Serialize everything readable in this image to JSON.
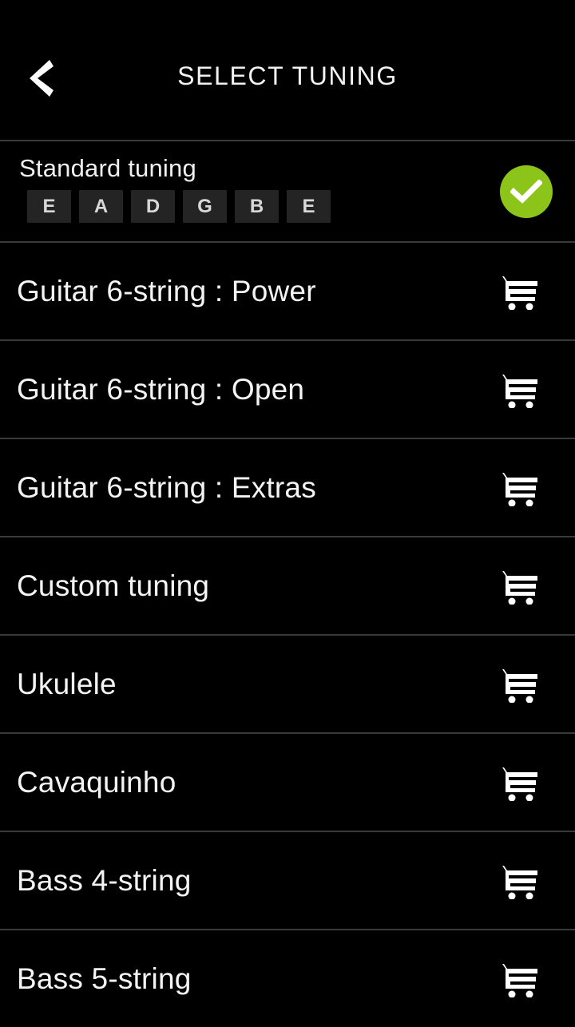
{
  "header": {
    "title": "SELECT TUNING",
    "back_icon": "chevron-left-icon"
  },
  "colors": {
    "background": "#000000",
    "divider": "#3a3a3a",
    "accent_green": "#8dc41a",
    "chip_background": "#242424",
    "chip_text": "#d8d8d8",
    "text": "#f4f4f4"
  },
  "selected_tuning": {
    "label": "Standard tuning",
    "strings": [
      "E",
      "A",
      "D",
      "G",
      "B",
      "E"
    ],
    "selected": true,
    "check_icon": "check-icon"
  },
  "list": {
    "items": [
      {
        "label": "Guitar 6-string : Power",
        "action_icon": "shopping-cart-icon",
        "locked": true
      },
      {
        "label": "Guitar 6-string : Open",
        "action_icon": "shopping-cart-icon",
        "locked": true
      },
      {
        "label": "Guitar 6-string : Extras",
        "action_icon": "shopping-cart-icon",
        "locked": true
      },
      {
        "label": "Custom tuning",
        "action_icon": "shopping-cart-icon",
        "locked": true
      },
      {
        "label": "Ukulele",
        "action_icon": "shopping-cart-icon",
        "locked": true
      },
      {
        "label": "Cavaquinho",
        "action_icon": "shopping-cart-icon",
        "locked": true
      },
      {
        "label": "Bass 4-string",
        "action_icon": "shopping-cart-icon",
        "locked": true
      },
      {
        "label": "Bass 5-string",
        "action_icon": "shopping-cart-icon",
        "locked": true
      }
    ]
  }
}
